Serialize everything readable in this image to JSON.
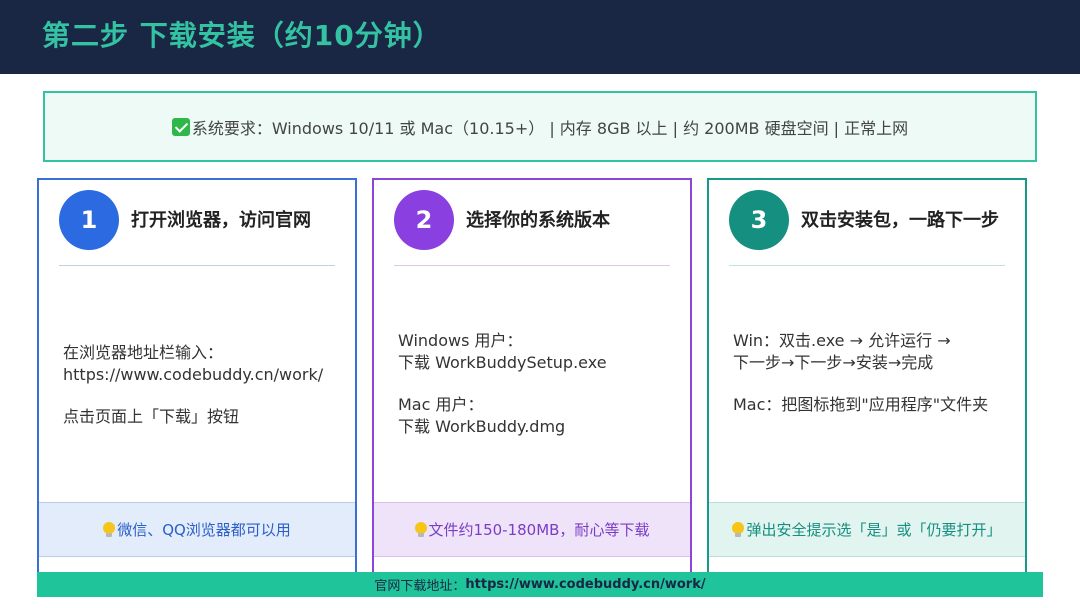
{
  "header": {
    "title": "第二步 下载安装（约10分钟）"
  },
  "requirements": {
    "text": "系统要求：Windows 10/11 或 Mac（10.15+） | 内存 8GB 以上 | 约 200MB 硬盘空间 | 正常上网",
    "icon": "check-icon"
  },
  "cards": [
    {
      "number": "1",
      "title": "打开浏览器，访问官网",
      "body": [
        "在浏览器地址栏输入：\nhttps://www.codebuddy.cn/work/",
        "点击页面上「下载」按钮"
      ],
      "tip": "微信、QQ浏览器都可以用",
      "accent": "#2b6ae0"
    },
    {
      "number": "2",
      "title": "选择你的系统版本",
      "body": [
        "Windows 用户：\n下载 WorkBuddySetup.exe",
        "Mac 用户：\n下载 WorkBuddy.dmg"
      ],
      "tip": "文件约150-180MB，耐心等下载",
      "accent": "#8a3fe0"
    },
    {
      "number": "3",
      "title": "双击安装包，一路下一步",
      "body": [
        "Win：双击.exe → 允许运行 →\n下一步→下一步→安装→完成",
        "Mac：把图标拖到\"应用程序\"文件夹"
      ],
      "tip": "弹出安全提示选「是」或「仍要打开」",
      "accent": "#148f80"
    }
  ],
  "footer": {
    "label": "官网下载地址：",
    "url": "https://www.codebuddy.cn/work/"
  },
  "colors": {
    "header_bg": "#1a2744",
    "title_accent": "#33c3a3",
    "footer_bg": "#1fc49a"
  }
}
